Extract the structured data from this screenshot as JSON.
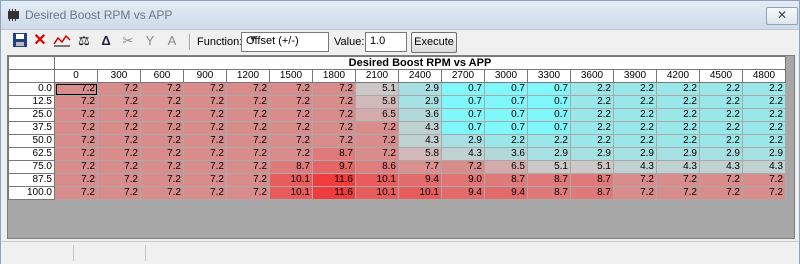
{
  "window": {
    "title": "Desired Boost RPM vs APP",
    "close_label": "✕"
  },
  "toolbar": {
    "buttons": [
      {
        "name": "save-icon",
        "glyph": "💾"
      },
      {
        "name": "delete-icon",
        "glyph": "✕"
      },
      {
        "name": "graph-icon",
        "glyph": "〰"
      },
      {
        "name": "balance-icon",
        "glyph": "⚖"
      },
      {
        "name": "compass-icon",
        "glyph": "Δ"
      },
      {
        "name": "cut-icon",
        "glyph": "✂"
      },
      {
        "name": "fork-icon",
        "glyph": "Y"
      },
      {
        "name": "text-icon",
        "glyph": "A"
      }
    ],
    "function_label": "Function:",
    "function_value": "Offset (+/-)",
    "value_label": "Value:",
    "value": "1.0",
    "execute_label": "Execute"
  },
  "table": {
    "title": "Desired Boost RPM vs APP",
    "columns": [
      "0",
      "300",
      "600",
      "900",
      "1200",
      "1500",
      "1800",
      "2100",
      "2400",
      "2700",
      "3000",
      "3300",
      "3600",
      "3900",
      "4200",
      "4500",
      "4800"
    ],
    "rows": [
      {
        "label": "0.0",
        "values": [
          "7.2",
          "7.2",
          "7.2",
          "7.2",
          "7.2",
          "7.2",
          "7.2",
          "5.1",
          "2.9",
          "0.7",
          "0.7",
          "0.7",
          "2.2",
          "2.2",
          "2.2",
          "2.2",
          "2.2"
        ]
      },
      {
        "label": "12.5",
        "values": [
          "7.2",
          "7.2",
          "7.2",
          "7.2",
          "7.2",
          "7.2",
          "7.2",
          "5.8",
          "2.9",
          "0.7",
          "0.7",
          "0.7",
          "2.2",
          "2.2",
          "2.2",
          "2.2",
          "2.2"
        ]
      },
      {
        "label": "25.0",
        "values": [
          "7.2",
          "7.2",
          "7.2",
          "7.2",
          "7.2",
          "7.2",
          "7.2",
          "6.5",
          "3.6",
          "0.7",
          "0.7",
          "0.7",
          "2.2",
          "2.2",
          "2.2",
          "2.2",
          "2.2"
        ]
      },
      {
        "label": "37.5",
        "values": [
          "7.2",
          "7.2",
          "7.2",
          "7.2",
          "7.2",
          "7.2",
          "7.2",
          "7.2",
          "4.3",
          "0.7",
          "0.7",
          "0.7",
          "2.2",
          "2.2",
          "2.2",
          "2.2",
          "2.2"
        ]
      },
      {
        "label": "50.0",
        "values": [
          "7.2",
          "7.2",
          "7.2",
          "7.2",
          "7.2",
          "7.2",
          "7.2",
          "7.2",
          "4.3",
          "2.9",
          "2.2",
          "2.2",
          "2.2",
          "2.2",
          "2.2",
          "2.2",
          "2.2"
        ]
      },
      {
        "label": "62.5",
        "values": [
          "7.2",
          "7.2",
          "7.2",
          "7.2",
          "7.2",
          "7.2",
          "8.7",
          "7.2",
          "5.8",
          "4.3",
          "3.6",
          "2.9",
          "2.9",
          "2.9",
          "2.9",
          "2.9",
          "2.9"
        ]
      },
      {
        "label": "75.0",
        "values": [
          "7.2",
          "7.2",
          "7.2",
          "7.2",
          "7.2",
          "8.7",
          "9.7",
          "8.6",
          "7.7",
          "7.2",
          "6.5",
          "5.1",
          "5.1",
          "4.3",
          "4.3",
          "4.3",
          "4.3"
        ]
      },
      {
        "label": "87.5",
        "values": [
          "7.2",
          "7.2",
          "7.2",
          "7.2",
          "7.2",
          "10.1",
          "11.6",
          "10.1",
          "9.4",
          "9.0",
          "8.7",
          "8.7",
          "8.7",
          "7.2",
          "7.2",
          "7.2",
          "7.2"
        ]
      },
      {
        "label": "100.0",
        "values": [
          "7.2",
          "7.2",
          "7.2",
          "7.2",
          "7.2",
          "10.1",
          "11.6",
          "10.1",
          "10.1",
          "9.4",
          "9.4",
          "8.7",
          "8.7",
          "7.2",
          "7.2",
          "7.2",
          "7.2"
        ]
      }
    ]
  },
  "colors": {
    "low": "#7ff7fb",
    "mid": "#c8c8c8",
    "high": "#f03c3c"
  }
}
